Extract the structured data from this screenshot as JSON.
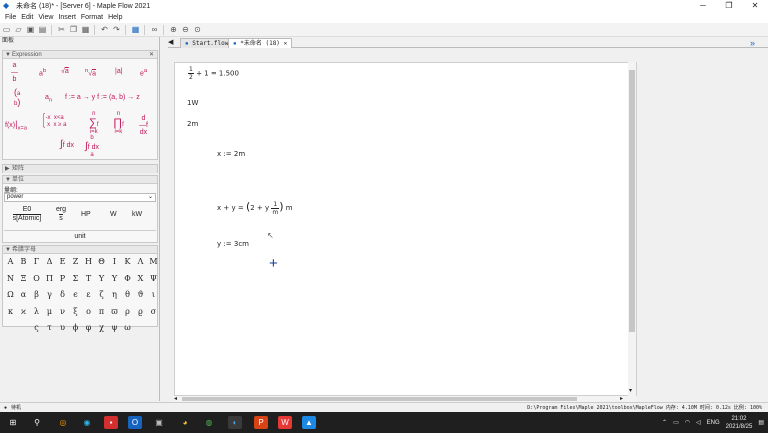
{
  "window": {
    "title": "未命名 (18)* - [Server 6] - Maple Flow 2021",
    "controls": [
      "─",
      "❐",
      "✕"
    ]
  },
  "menu": [
    "File",
    "Edit",
    "View",
    "Insert",
    "Format",
    "Help"
  ],
  "left_panel": {
    "header": "面板",
    "expression": {
      "title": "Expression",
      "items": [
        {
          "label": "a/b"
        },
        {
          "label": "a^b"
        },
        {
          "label": "√a"
        },
        {
          "label": "ⁿ√a"
        },
        {
          "label": "|a|"
        },
        {
          "label": "e^a"
        },
        {
          "label": "(a b)"
        },
        {
          "label": "a_n"
        },
        {
          "label": "f := a → y  f := (a, b) → z"
        },
        {
          "label": "f(x) |x=a"
        },
        {
          "label": "-x  x<a ; x  x≥a"
        },
        {
          "label": "Σ f"
        },
        {
          "label": "Π f"
        },
        {
          "label": "d/dx f"
        },
        {
          "label": "∫ f dx"
        },
        {
          "label": "∫ab f dx"
        }
      ]
    },
    "sections": [
      "矩阵",
      "单位"
    ],
    "unit": {
      "filter_label": "量纲:",
      "dropdown_value": "power",
      "buttons": [
        "E0",
        "s[Atomic]",
        "erg",
        "s",
        "HP",
        "W",
        "kW"
      ],
      "unit_button": "unit"
    },
    "greek": {
      "title": "希腊字母",
      "letters": [
        "Α",
        "Β",
        "Γ",
        "Δ",
        "Ε",
        "Ζ",
        "Η",
        "Θ",
        "Ι",
        "Κ",
        "Λ",
        "Μ",
        "Ν",
        "Ξ",
        "Ο",
        "Π",
        "Ρ",
        "Σ",
        "Τ",
        "Υ",
        "Υ",
        "Φ",
        "Χ",
        "Ψ",
        "Ω",
        "α",
        "β",
        "γ",
        "δ",
        "ϵ",
        "ε",
        "ζ",
        "η",
        "θ",
        "ϑ",
        "ι",
        "κ",
        "ϰ",
        "λ",
        "μ",
        "ν",
        "ξ",
        "ο",
        "π",
        "ϖ",
        "ρ",
        "ϱ",
        "σ",
        "ς",
        "τ",
        "υ",
        "ϕ",
        "φ",
        "χ",
        "ψ",
        "ω"
      ]
    }
  },
  "tabs": [
    {
      "label": "Start.flow",
      "close": "✕"
    },
    {
      "label": "*未命名 (18)",
      "close": "✕"
    }
  ],
  "document": {
    "line1": {
      "num": "1",
      "den": "2",
      "rest": "+ 1 = 1.500"
    },
    "line2": "1W",
    "line3": "2m",
    "line4": {
      "var": "x",
      "op": ":=",
      "val": "2m"
    },
    "line5": {
      "lhs": "x + y =",
      "open": "(",
      "two": "2 + y",
      "num": "1",
      "den": "m",
      "close": ")",
      "unit": "m"
    },
    "line6": {
      "var": "y",
      "op": ":=",
      "val": "3cm"
    },
    "cursor": "+"
  },
  "status": {
    "left": "待机",
    "right": "D:\\Program Files\\Maple 2021\\toolbox\\MapleFlow   内存: 4.10M   时间: 0.12s   比例: 100%"
  },
  "taskbar": {
    "tray_lang": "ENG",
    "time": "21:02",
    "date": "2021/8/25"
  }
}
